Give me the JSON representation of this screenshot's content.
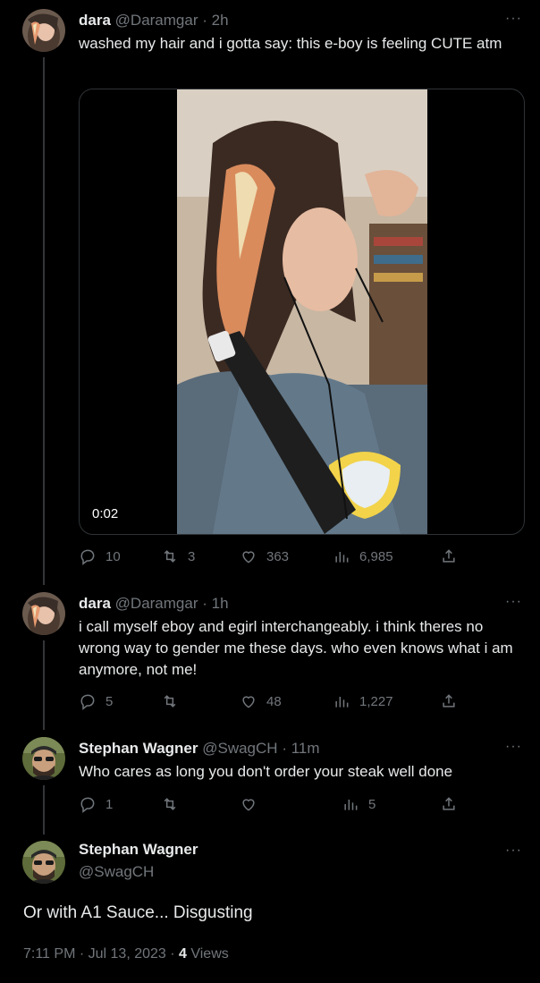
{
  "tweets": [
    {
      "name": "dara",
      "handle": "@Daramgar",
      "time": "2h",
      "text": "washed my hair and i gotta say: this e-boy is feeling CUTE atm",
      "video_duration": "0:02",
      "replies": "10",
      "retweets": "3",
      "likes": "363",
      "views": "6,985"
    },
    {
      "name": "dara",
      "handle": "@Daramgar",
      "time": "1h",
      "text": "i call myself eboy and egirl interchangeably. i think theres no wrong way to gender me these days. who even knows what i am anymore, not me!",
      "replies": "5",
      "retweets": "",
      "likes": "48",
      "views": "1,227"
    },
    {
      "name": "Stephan Wagner",
      "handle": "@SwagCH",
      "time": "11m",
      "text": "Who cares as long you don't order your steak well done",
      "replies": "1",
      "retweets": "",
      "likes": "",
      "views": "5"
    }
  ],
  "focused": {
    "name": "Stephan Wagner",
    "handle": "@SwagCH",
    "text": "Or with A1 Sauce... Disgusting",
    "timestamp": "7:11 PM · Jul 13, 2023 · ",
    "views_count": "4",
    "views_label": " Views"
  },
  "ui": {
    "dot": "·",
    "more": "···"
  },
  "colors": {
    "bg": "#000000",
    "muted": "#71767b",
    "text": "#e7e9ea",
    "line": "#333639"
  }
}
